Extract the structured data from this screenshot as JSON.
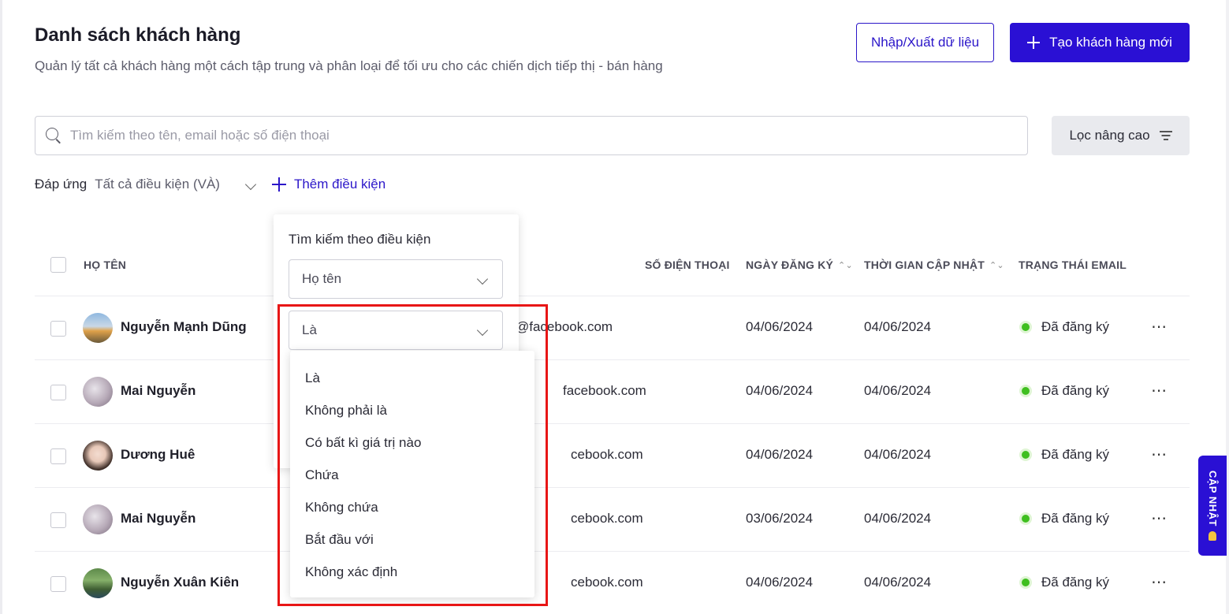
{
  "header": {
    "title": "Danh sách khách hàng",
    "subtitle": "Quản lý tất cả khách hàng một cách tập trung và phân loại để tối ưu cho các chiến dịch tiếp thị - bán hàng",
    "import_export_label": "Nhập/Xuất dữ liệu",
    "create_label": "Tạo khách hàng mới"
  },
  "search": {
    "placeholder": "Tìm kiếm theo tên, email hoặc số điện thoại",
    "advanced_filter_label": "Lọc nâng cao"
  },
  "conditions": {
    "match_label": "Đáp ứng",
    "match_value": "Tất cả điều kiện (VÀ)",
    "add_label": "Thêm điều kiện"
  },
  "table": {
    "columns": {
      "name": "HỌ TÊN",
      "phone": "SỐ ĐIỆN THOẠI",
      "registered": "NGÀY ĐĂNG KÝ",
      "updated": "THỜI GIAN CẬP NHẬT",
      "email_status": "TRẠNG THÁI EMAIL"
    },
    "rows": [
      {
        "name": "Nguyễn Mạnh Dũng",
        "email": "@facebook.com",
        "registered": "04/06/2024",
        "updated": "04/06/2024",
        "status": "Đã đăng ký"
      },
      {
        "name": "Mai Nguyễn",
        "email": "facebook.com",
        "registered": "04/06/2024",
        "updated": "04/06/2024",
        "status": "Đã đăng ký"
      },
      {
        "name": "Dương Huê",
        "email": "cebook.com",
        "registered": "04/06/2024",
        "updated": "04/06/2024",
        "status": "Đã đăng ký"
      },
      {
        "name": "Mai Nguyễn",
        "email": "cebook.com",
        "registered": "03/06/2024",
        "updated": "04/06/2024",
        "status": "Đã đăng ký"
      },
      {
        "name": "Nguyễn Xuân Kiên",
        "email": "cebook.com",
        "registered": "04/06/2024",
        "updated": "04/06/2024",
        "status": "Đã đăng ký"
      }
    ]
  },
  "condition_popover": {
    "title": "Tìm kiếm theo điều kiện",
    "field_value": "Họ tên",
    "operator_value": "Là",
    "operator_options": [
      "Là",
      "Không phải là",
      "Có bất kì giá trị nào",
      "Chứa",
      "Không chứa",
      "Bắt đầu với",
      "Không xác định"
    ]
  },
  "side_tab": {
    "label": "CẬP NHẬT"
  },
  "colors": {
    "accent": "#2a10d4",
    "status_ok": "#3fbf1f",
    "highlight": "#e81616"
  }
}
